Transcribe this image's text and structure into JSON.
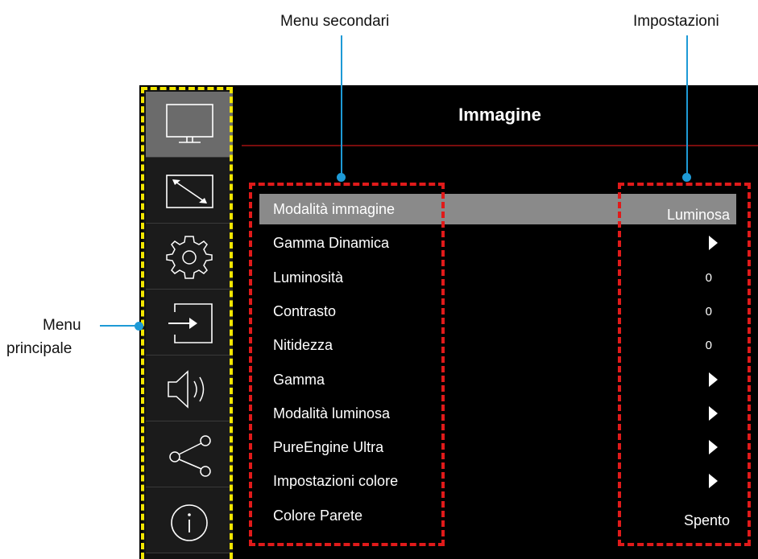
{
  "callouts": {
    "submenu": "Menu secondari",
    "settings": "Impostazioni",
    "main_menu_line1": "Menu",
    "main_menu_line2": "principale"
  },
  "header": {
    "title": "Immagine"
  },
  "sidebar": {
    "items": [
      {
        "icon": "monitor-icon",
        "active": true
      },
      {
        "icon": "resize-icon",
        "active": false
      },
      {
        "icon": "gear-icon",
        "active": false
      },
      {
        "icon": "input-icon",
        "active": false
      },
      {
        "icon": "speaker-icon",
        "active": false
      },
      {
        "icon": "share-icon",
        "active": false
      },
      {
        "icon": "info-icon",
        "active": false
      }
    ]
  },
  "menu": {
    "rows": [
      {
        "label": "Modalità immagine",
        "value": "Luminosa",
        "kind": "text",
        "selected": true
      },
      {
        "label": "Gamma Dinamica",
        "value": "",
        "kind": "arrow"
      },
      {
        "label": "Luminosità",
        "value": "0",
        "kind": "number"
      },
      {
        "label": "Contrasto",
        "value": "0",
        "kind": "number"
      },
      {
        "label": "Nitidezza",
        "value": "0",
        "kind": "number"
      },
      {
        "label": "Gamma",
        "value": "",
        "kind": "arrow"
      },
      {
        "label": "Modalità luminosa",
        "value": "",
        "kind": "arrow"
      },
      {
        "label": "PureEngine Ultra",
        "value": "",
        "kind": "arrow"
      },
      {
        "label": "Impostazioni colore",
        "value": "",
        "kind": "arrow"
      },
      {
        "label": "Colore Parete",
        "value": "Spento",
        "kind": "text"
      }
    ]
  },
  "colors": {
    "callout_blue": "#1e9ad6",
    "highlight_yellow": "#f2e600",
    "highlight_red": "#e01a1a",
    "selected_row": "#8a8a8a",
    "active_sidebar": "#6b6b6b"
  }
}
